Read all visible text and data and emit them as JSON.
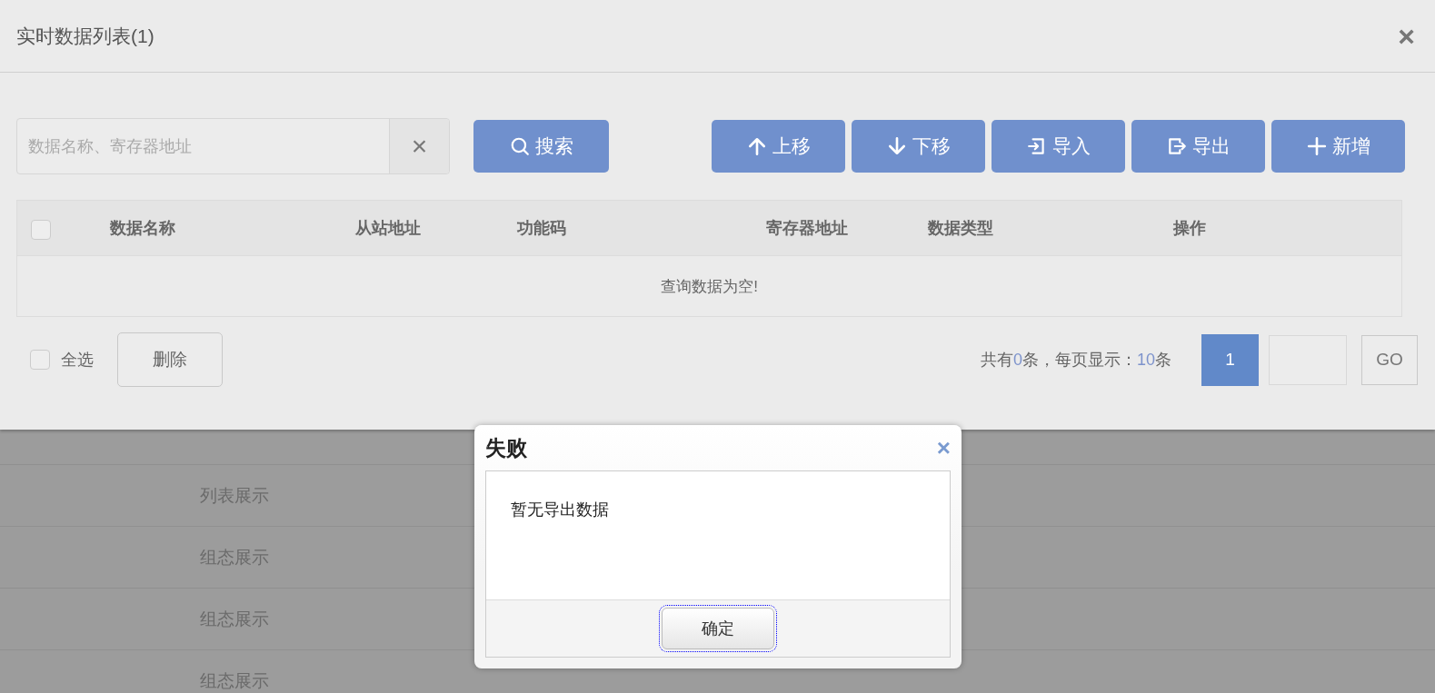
{
  "background_list": {
    "rows": [
      {
        "label": "列表展示"
      },
      {
        "label": "组态展示"
      },
      {
        "label": "组态展示"
      },
      {
        "label": "组态展示"
      }
    ]
  },
  "panel": {
    "title": "实时数据列表(1)",
    "close": "×",
    "search": {
      "placeholder": "数据名称、寄存器地址",
      "clear": "×",
      "button": "搜索"
    },
    "toolbar": [
      {
        "kind": "up",
        "label": "上移"
      },
      {
        "kind": "down",
        "label": "下移"
      },
      {
        "kind": "import",
        "label": "导入"
      },
      {
        "kind": "export",
        "label": "导出"
      },
      {
        "kind": "add",
        "label": "新增"
      }
    ],
    "table": {
      "header_checked": false,
      "columns": [
        "数据名称",
        "从站地址",
        "功能码",
        "寄存器地址",
        "数据类型",
        "操作"
      ],
      "empty_text": "查询数据为空!"
    },
    "footer": {
      "select_all": {
        "label": "全选",
        "checked": false
      },
      "delete_button": "删除",
      "summary": {
        "prefix": "共有",
        "total": "0",
        "middle": "条，每页显示：",
        "page_size": "10",
        "suffix": "条"
      },
      "pages": [
        {
          "label": "1",
          "selected": true
        }
      ],
      "go_button": "GO"
    }
  },
  "dialog": {
    "title": "失败",
    "close": "×",
    "message": "暂无导出数据",
    "ok_button": "确定"
  }
}
